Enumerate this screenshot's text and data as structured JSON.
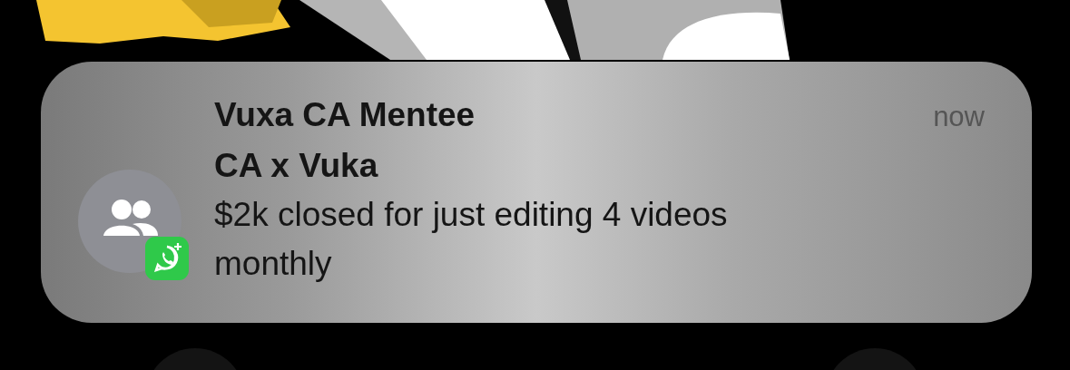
{
  "notification": {
    "sender": "Vuxa CA Mentee",
    "subtitle": "CA x Vuka",
    "message": "$2k closed for just editing 4 videos monthly",
    "time": "now"
  }
}
